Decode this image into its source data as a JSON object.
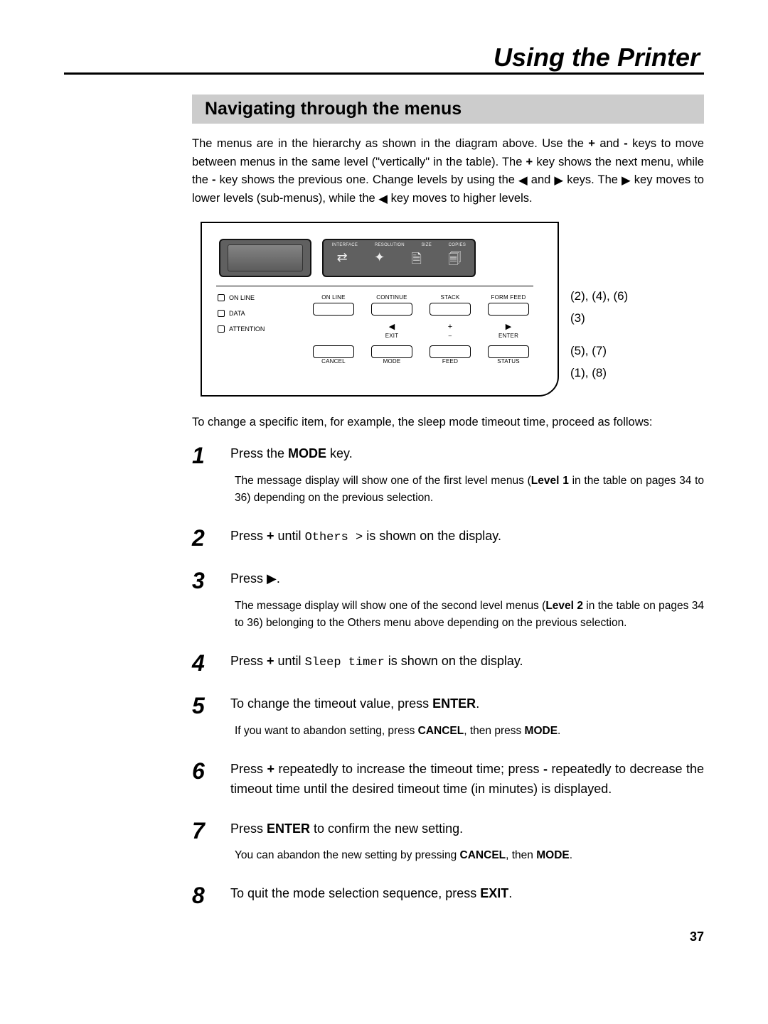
{
  "title": "Using the Printer",
  "section_header": "Navigating through the menus",
  "intro": {
    "t1": "The menus are in the hierarchy as shown in the diagram above. Use the ",
    "plus1": "+",
    "t2": " and ",
    "minus1": "-",
    "t3": " keys to move between menus in the same level (\"vertically\" in the table). The ",
    "plus2": "+",
    "t4": " key shows the next menu, while the ",
    "minus2": "-",
    "t5": " key shows the previous one. Change levels by using the ",
    "left_tri1": "◀",
    "t6": " and ",
    "right_tri1": "▶",
    "t7": " keys.  The ",
    "right_tri2": "▶",
    "t8": " key moves to lower levels (sub-menus), while the ",
    "left_tri2": "◀",
    "t9": " key moves to higher levels."
  },
  "panel_icon_labels": [
    "INTERFACE",
    "RESOLUTION",
    "SIZE",
    "COPIES"
  ],
  "panel_leds": [
    "ON LINE",
    "DATA",
    "ATTENTION"
  ],
  "panel_buttons": {
    "row1": [
      "ON LINE",
      "CONTINUE",
      "STACK",
      "FORM FEED"
    ],
    "row2_syms": [
      "◀",
      "+",
      "▶"
    ],
    "row2": [
      "EXIT",
      "–",
      "ENTER"
    ],
    "row3": [
      "CANCEL",
      "MODE",
      "FEED",
      "STATUS"
    ]
  },
  "callouts": [
    "(2), (4), (6)",
    "(3)",
    "(5), (7)",
    "(1), (8)"
  ],
  "lead_line": "To change a specific item, for example, the sleep mode timeout time, proceed as follows:",
  "steps": [
    {
      "num": "1",
      "head_pre": "Press the ",
      "head_bold": "MODE",
      "head_post": " key.",
      "sub_pre": "The message display will show one of the first level menus (",
      "sub_bold": "Level 1",
      "sub_post": " in the table on pages 34 to 36) depending on the previous selection."
    },
    {
      "num": "2",
      "head_pre": "Press ",
      "head_bold": "+",
      "head_post": " until ",
      "head_code": "Others  >",
      "head_tail": " is shown on the display."
    },
    {
      "num": "3",
      "head_pre": "Press ",
      "head_glyph": "▶",
      "head_post": ".",
      "sub_pre": "The message display will show one of the second level menus (",
      "sub_bold": "Level 2",
      "sub_post": " in the table on pages 34 to 36) belonging to the Others menu above depending on the previous selection."
    },
    {
      "num": "4",
      "head_pre": "Press ",
      "head_bold": "+",
      "head_post": " until ",
      "head_code": "Sleep  timer",
      "head_tail": " is shown on the display."
    },
    {
      "num": "5",
      "head_pre": "To change the timeout value, press ",
      "head_bold": "ENTER",
      "head_post": ".",
      "sub_pre": " If you want to abandon setting, press ",
      "sub_bold": "CANCEL",
      "sub_post": ", then press ",
      "sub_bold2": "MODE",
      "sub_tail": "."
    },
    {
      "num": "6",
      "head_pre": "Press ",
      "head_bold": "+",
      "head_post": " repeatedly to increase the timeout time; press ",
      "head_bold2": "-",
      "head_tail": " repeatedly to decrease the timeout time until the desired timeout time (in minutes) is displayed."
    },
    {
      "num": "7",
      "head_pre": "Press ",
      "head_bold": "ENTER",
      "head_post": " to confirm the new setting.",
      "sub_pre": " You can abandon the new setting by pressing ",
      "sub_bold": "CANCEL",
      "sub_post": ", then ",
      "sub_bold2": "MODE",
      "sub_tail": "."
    },
    {
      "num": "8",
      "head_pre": "To quit the mode selection sequence, press ",
      "head_bold": "EXIT",
      "head_post": "."
    }
  ],
  "page_number": "37"
}
